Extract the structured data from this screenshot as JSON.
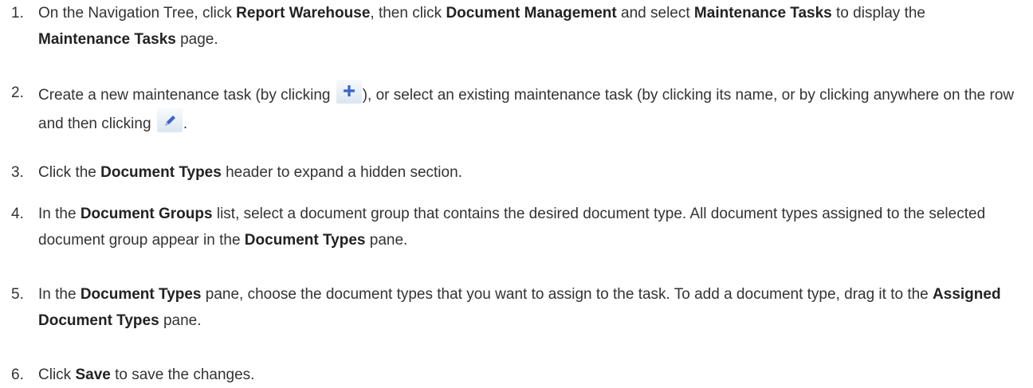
{
  "steps": [
    {
      "number": "1.",
      "parts": {
        "a": "On the Navigation Tree, click ",
        "b": "Report Warehouse",
        "c": ", then click ",
        "d": "Document Management",
        "e": " and select ",
        "f": "Maintenance Tasks",
        "g": " to display the ",
        "h": "Maintenance Tasks",
        "i": " page."
      }
    },
    {
      "number": "2.",
      "parts": {
        "a": "Create a new maintenance task (by clicking ",
        "b": "), or select an existing maintenance task (by clicking its name, or by clicking anywhere on the row and then clicking ",
        "c": "."
      },
      "icons": [
        "plus-icon",
        "pencil-icon"
      ]
    },
    {
      "number": "3.",
      "parts": {
        "a": "Click the ",
        "b": "Document Types",
        "c": " header to expand a hidden section."
      }
    },
    {
      "number": "4.",
      "parts": {
        "a": "In the ",
        "b": "Document Groups",
        "c": " list, select a document group that contains the desired document type. All document types assigned to the selected document group appear in the ",
        "d": "Document Types",
        "e": " pane."
      }
    },
    {
      "number": "5.",
      "parts": {
        "a": "In the ",
        "b": "Document Types",
        "c": " pane, choose the document types that you want to assign to the task. To add a document type, drag it to the ",
        "d": "Assigned Document Types",
        "e": " pane."
      }
    },
    {
      "number": "6.",
      "parts": {
        "a": "Click ",
        "b": "Save",
        "c": " to save the changes."
      }
    }
  ],
  "colors": {
    "text": "#333333",
    "icon_blue": "#3a64c8",
    "icon_bg": "#dbe6f2"
  }
}
